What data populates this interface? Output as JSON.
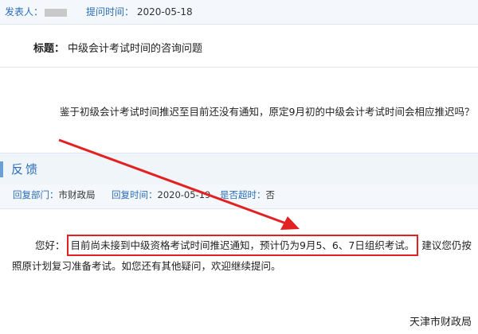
{
  "question_meta": {
    "publisher_label": "发表人：",
    "time_label": "提问时间：",
    "time_value": "2020-05-18"
  },
  "subject": {
    "label": "标题：",
    "value": "中级会计考试时间的咨询问题"
  },
  "question_text": "鉴于初级会计考试时间推迟至目前还没有通知，原定9月初的中级会计考试时间会相应推迟吗？",
  "feedback": {
    "title": "反馈"
  },
  "reply_meta": {
    "dept_label": "回复部门：",
    "dept_value": "市财政局",
    "time_label": "回复时间：",
    "time_value": "2020-05-19",
    "overtime_label": "是否超时：",
    "overtime_value": "否"
  },
  "answer": {
    "greeting": "您好：",
    "highlight": "目前尚未接到中级资格考试时间推迟通知，预计仍为9月5、6、7日组织考试。",
    "rest_line1": "建议您仍按",
    "line2": "照原计划复习准备考试。如您还有其他疑问，欢迎继续提问。"
  },
  "signature": "天津市财政局",
  "colors": {
    "label_blue": "#2a6db5",
    "annotation_red": "#e22222"
  }
}
